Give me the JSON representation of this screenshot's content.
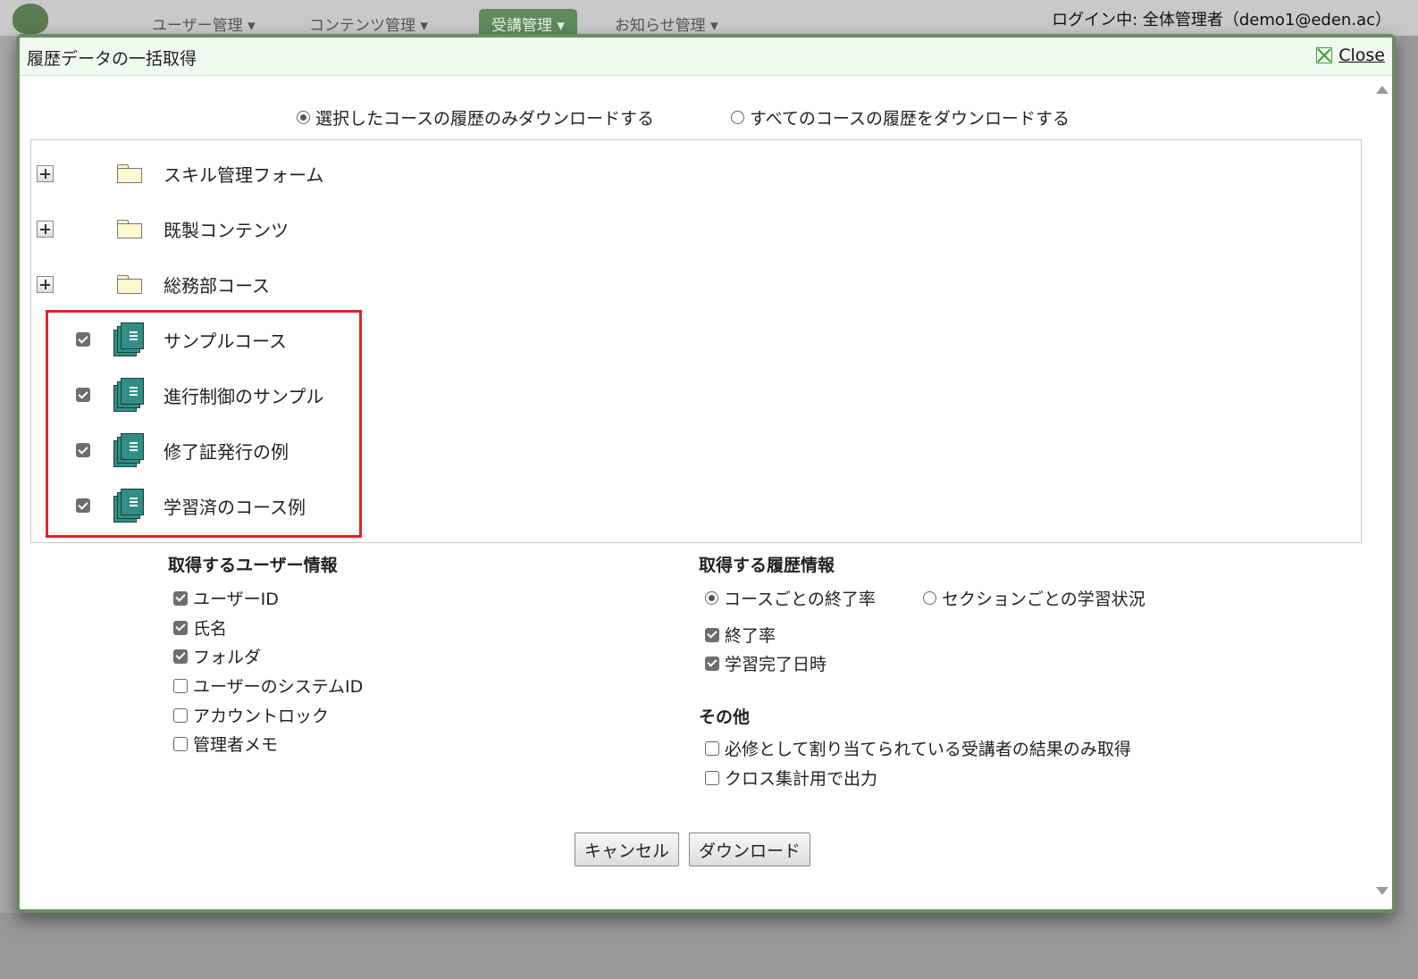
{
  "background": {
    "nav": [
      "ユーザー管理 ▾",
      "コンテンツ管理 ▾",
      "受講管理 ▾",
      "お知らせ管理 ▾"
    ],
    "login_text": "ログイン中: 全体管理者（demo1@eden.ac）"
  },
  "dialog": {
    "title": "履歴データの一括取得",
    "close_label": "Close",
    "scope": {
      "selected_label": "選択したコースの履歴のみダウンロードする",
      "all_label": "すべてのコースの履歴をダウンロードする",
      "selected": "selected"
    },
    "tree": {
      "folders": [
        {
          "label": "スキル管理フォーム"
        },
        {
          "label": "既製コンテンツ"
        },
        {
          "label": "総務部コース"
        }
      ],
      "courses": [
        {
          "label": "サンプルコース",
          "checked": true
        },
        {
          "label": "進行制御のサンプル",
          "checked": true
        },
        {
          "label": "修了証発行の例",
          "checked": true
        },
        {
          "label": "学習済のコース例",
          "checked": true
        }
      ]
    },
    "user_info": {
      "title": "取得するユーザー情報",
      "options": [
        {
          "label": "ユーザーID",
          "checked": true
        },
        {
          "label": "氏名",
          "checked": true
        },
        {
          "label": "フォルダ",
          "checked": true
        },
        {
          "label": "ユーザーのシステムID",
          "checked": false
        },
        {
          "label": "アカウントロック",
          "checked": false
        },
        {
          "label": "管理者メモ",
          "checked": false
        }
      ]
    },
    "history_info": {
      "title": "取得する履歴情報",
      "mode_course_label": "コースごとの終了率",
      "mode_section_label": "セクションごとの学習状況",
      "mode_selected": "course",
      "options": [
        {
          "label": "終了率",
          "checked": true
        },
        {
          "label": "学習完了日時",
          "checked": true
        }
      ]
    },
    "other": {
      "title": "その他",
      "options": [
        {
          "label": "必修として割り当てられている受講者の結果のみ取得",
          "checked": false
        },
        {
          "label": "クロス集計用で出力",
          "checked": false
        }
      ]
    },
    "buttons": {
      "cancel_label": "キャンセル",
      "download_label": "ダウンロード"
    }
  }
}
